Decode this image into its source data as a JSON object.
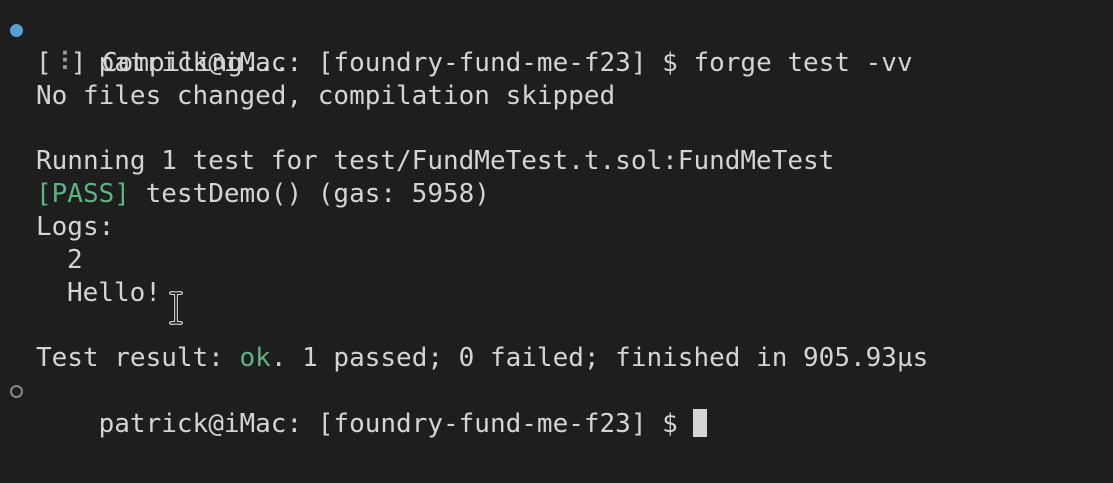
{
  "terminal": {
    "prompt": "patrick@iMac: [foundry-fund-me-f23] $",
    "command": " forge test -vv",
    "compile_open": "[",
    "spinner": "⠸",
    "compile_close": "] Compiling...",
    "no_changes": "No files changed, compilation skipped",
    "running": "Running 1 test for test/FundMeTest.t.sol:FundMeTest",
    "pass_tag": "[PASS]",
    "test_line": " testDemo() (gas: 5958)",
    "logs_label": "Logs:",
    "log_values": [
      "2",
      "Hello!"
    ],
    "result_prefix": "Test result: ",
    "result_ok": "ok",
    "result_suffix": ". 1 passed; 0 failed; finished in 905.93µs",
    "prompt_end": "patrick@iMac: [foundry-fund-me-f23] $ "
  },
  "colors": {
    "background": "#1e1e1e",
    "text": "#d4d4d4",
    "success": "#5fb380",
    "status_marker": "#5a9fd4"
  },
  "icons": {
    "previous_command_marker": "filled-circle-icon",
    "current_command_marker": "hollow-circle-icon",
    "mouse_pointer": "text-cursor-icon"
  }
}
